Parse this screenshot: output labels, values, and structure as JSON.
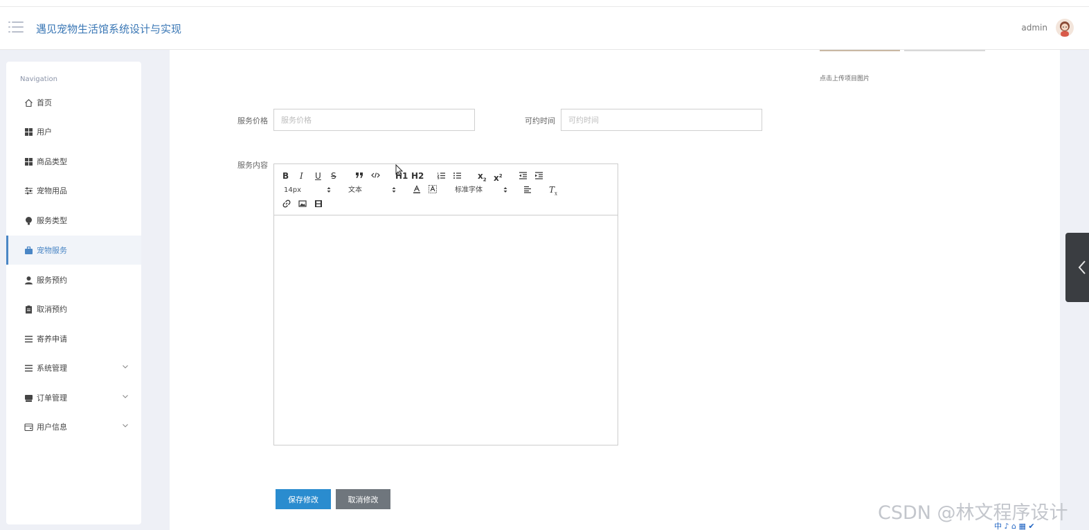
{
  "header": {
    "title": "遇见宠物生活馆系统设计与实现",
    "user": "admin"
  },
  "sidebar": {
    "heading": "Navigation",
    "items": [
      {
        "label": "首页",
        "icon": "home-icon"
      },
      {
        "label": "用户",
        "icon": "grid-icon"
      },
      {
        "label": "商品类型",
        "icon": "grid-icon"
      },
      {
        "label": "宠物用品",
        "icon": "sliders-icon"
      },
      {
        "label": "服务类型",
        "icon": "bulb-icon"
      },
      {
        "label": "宠物服务",
        "icon": "briefcase-icon",
        "active": true
      },
      {
        "label": "服务预约",
        "icon": "user-icon"
      },
      {
        "label": "取消预约",
        "icon": "clipboard-icon"
      },
      {
        "label": "寄养申请",
        "icon": "list-icon"
      },
      {
        "label": "系统管理",
        "icon": "list-icon",
        "expandable": true
      },
      {
        "label": "订单管理",
        "icon": "inbox-icon",
        "expandable": true
      },
      {
        "label": "用户信息",
        "icon": "card-icon",
        "expandable": true
      }
    ]
  },
  "form": {
    "upload_hint": "点击上传项目图片",
    "price_label": "服务价格",
    "price_placeholder": "服务价格",
    "time_label": "可约时间",
    "time_placeholder": "可约时间",
    "content_label": "服务内容",
    "editor": {
      "font_size": "14px",
      "header_select": "文本",
      "font_select": "标准字体",
      "h1": "H1",
      "h2": "H2"
    },
    "save_button": "保存修改",
    "cancel_button": "取消修改"
  },
  "watermark": "CSDN @林文程序设计",
  "tray": "中 ♪ ⌂ ▦ ✔",
  "colors": {
    "accent": "#2a8ccf",
    "title": "#3a77b5",
    "active_nav": "#4a86c5",
    "cancel": "#6f767d"
  }
}
